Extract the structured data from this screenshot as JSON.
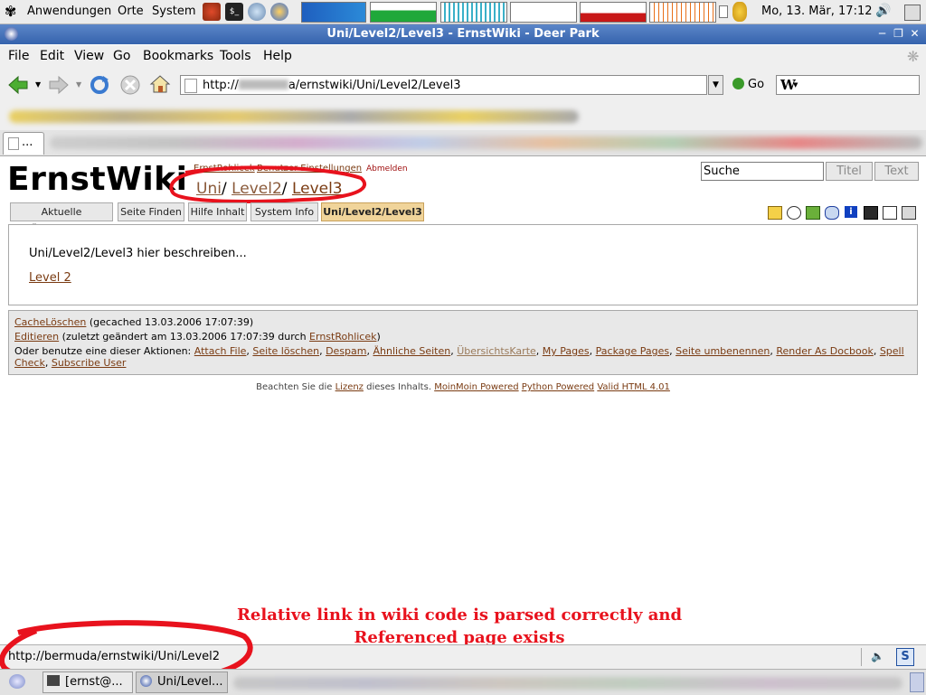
{
  "panel": {
    "menus": [
      "Anwendungen",
      "Orte",
      "System"
    ],
    "clock": "Mo, 13. Mär, 17:12"
  },
  "window": {
    "title": "Uni/Level2/Level3 - ErnstWiki - Deer Park"
  },
  "browser": {
    "menus": [
      "File",
      "Edit",
      "View",
      "Go",
      "Bookmarks",
      "Tools",
      "Help"
    ],
    "url_prefix": "http://",
    "url_suffix": "a/ernstwiki/Uni/Level2/Level3",
    "go_label": "Go",
    "search_engine_icon": "W",
    "tab_label": "..."
  },
  "wiki": {
    "logo": "ErnstWiki",
    "user_links": [
      "ErnstRohlicek",
      "Benutzer Einstellungen",
      "Abmelden"
    ],
    "breadcrumb": [
      "Uni",
      "Level2",
      "Level3"
    ],
    "search_value": "Suche",
    "search_title_btn": "Titel",
    "search_text_btn": "Text",
    "nav_tabs": [
      "Aktuelle Änderungen",
      "Seite Finden",
      "Hilfe Inhalt",
      "System Info",
      "Uni/Level2/Level3"
    ],
    "content_text": "Uni/Level2/Level3 hier beschreiben...",
    "content_link": "Level 2",
    "footer": {
      "cache_link": "CacheLöschen",
      "cache_text": "(gecached 13.03.2006 17:07:39)",
      "edit_link": "Editieren",
      "edit_text": "(zuletzt geändert am 13.03.2006 17:07:39 durch",
      "edit_user": "ErnstRohlicek",
      "edit_close": ")",
      "actions_intro": "Oder benutze eine dieser Aktionen:",
      "actions": [
        "Attach File",
        "Seite löschen",
        "Despam",
        "Ähnliche Seiten",
        "ÜbersichtsKarte",
        "My Pages",
        "Package Pages",
        "Seite umbenennen",
        "Render As Docbook",
        "Spell Check",
        "Subscribe User"
      ]
    },
    "credits": {
      "pre": "Beachten Sie die",
      "lizenz": "Lizenz",
      "mid": "dieses Inhalts.",
      "links": [
        "MoinMoin Powered",
        "Python Powered",
        "Valid HTML 4.01"
      ]
    }
  },
  "annotation": {
    "line1": "Relative link in wiki code is parsed correctly and",
    "line2": "Referenced page exists"
  },
  "status_url": "http://bermuda/ernstwiki/Uni/Level2",
  "taskbar": {
    "tasks": [
      "[ernst@...",
      "Uni/Level..."
    ]
  },
  "colors": {
    "annotation": "#e8121d",
    "link": "#7a3b12",
    "titlebar": "#3a67b1"
  }
}
